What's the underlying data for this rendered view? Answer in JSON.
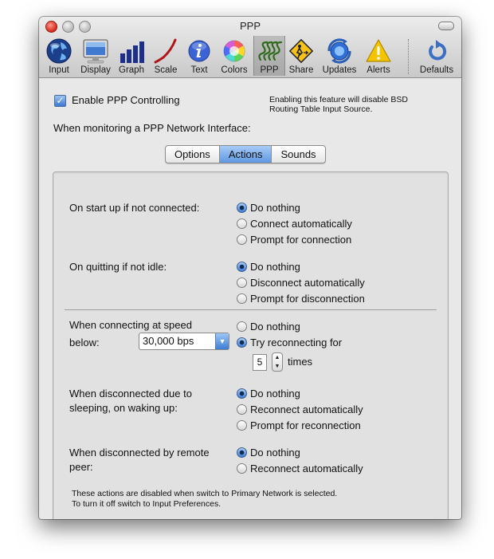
{
  "window": {
    "title": "PPP"
  },
  "toolbar": {
    "items": [
      {
        "label": "Input"
      },
      {
        "label": "Display"
      },
      {
        "label": "Graph"
      },
      {
        "label": "Scale"
      },
      {
        "label": "Text"
      },
      {
        "label": "Colors"
      },
      {
        "label": "PPP"
      },
      {
        "label": "Share"
      },
      {
        "label": "Updates"
      },
      {
        "label": "Alerts"
      },
      {
        "label": "Defaults"
      }
    ],
    "selected": "PPP"
  },
  "enable": {
    "label": "Enable PPP Controlling",
    "checked": true,
    "note_line1": "Enabling this feature will disable BSD",
    "note_line2": "Routing Table Input Source."
  },
  "monitor_heading": "When monitoring a PPP Network Interface:",
  "tabs": {
    "options": "Options",
    "actions": "Actions",
    "sounds": "Sounds",
    "selected": "Actions"
  },
  "startup": {
    "label": "On start up if not connected:",
    "options": [
      "Do nothing",
      "Connect automatically",
      "Prompt for connection"
    ],
    "selected": 0
  },
  "quitting": {
    "label": "On quitting if not idle:",
    "options": [
      "Do nothing",
      "Disconnect automatically",
      "Prompt for disconnection"
    ],
    "selected": 0
  },
  "speed": {
    "label_line1": "When connecting at speed",
    "label_line2": "below:",
    "speed_value": "30,000 bps",
    "options": [
      "Do nothing",
      "Try reconnecting for"
    ],
    "selected": 1,
    "times_value": "5",
    "times_label": "times"
  },
  "sleeping": {
    "label_line1": "When disconnected due to",
    "label_line2": "sleeping, on waking up:",
    "options": [
      "Do nothing",
      "Reconnect automatically",
      "Prompt for reconnection"
    ],
    "selected": 0
  },
  "remote": {
    "label_line1": "When disconnected by remote",
    "label_line2": "peer:",
    "options": [
      "Do nothing",
      "Reconnect automatically"
    ],
    "selected": 0
  },
  "footnote": {
    "line1": "These actions are disabled when switch to Primary Network is selected.",
    "line2": "To turn it off switch to Input Preferences."
  },
  "colors": {
    "accent": "#3d7bd6",
    "window_bg": "#e8e8e8"
  }
}
